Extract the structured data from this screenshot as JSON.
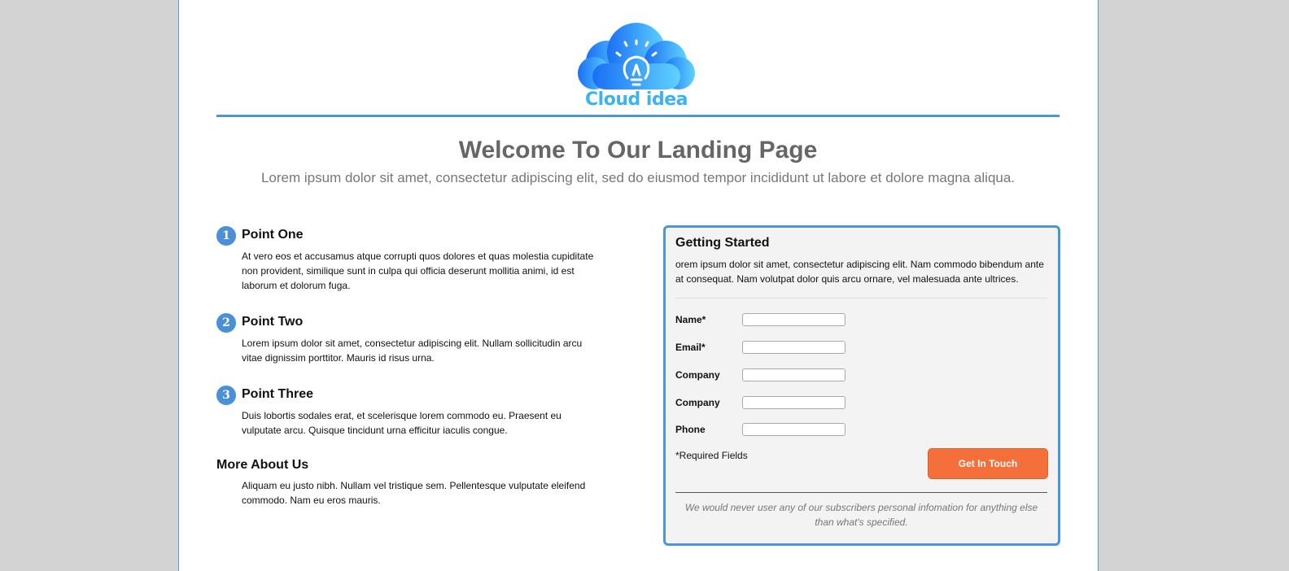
{
  "logo": {
    "text": "Cloud idea"
  },
  "hero": {
    "title": "Welcome To Our Landing Page",
    "subtitle": "Lorem ipsum dolor sit amet, consectetur adipiscing elit, sed do eiusmod tempor incididunt ut labore et dolore magna aliqua."
  },
  "points": [
    {
      "number": "1",
      "title": "Point One",
      "text": "At vero eos et accusamus atque corrupti quos dolores et quas molestia cupiditate non provident, similique sunt in culpa qui officia deserunt mollitia animi, id est laborum et dolorum fuga."
    },
    {
      "number": "2",
      "title": "Point Two",
      "text": "Lorem ipsum dolor sit amet, consectetur adipiscing elit. Nullam sollicitudin arcu vitae dignissim porttitor. Mauris id risus urna."
    },
    {
      "number": "3",
      "title": "Point Three",
      "text": "Duis lobortis sodales erat, et scelerisque lorem commodo eu. Praesent eu vulputate arcu. Quisque tincidunt urna efficitur iaculis congue."
    }
  ],
  "more": {
    "title": "More About Us",
    "text": "Aliquam eu justo nibh. Nullam vel tristique sem. Pellentesque vulputate eleifend commodo. Nam eu eros mauris."
  },
  "form": {
    "title": "Getting Started",
    "intro": "orem ipsum dolor sit amet, consectetur adipiscing elit. Nam commodo bibendum ante at consequat. Nam volutpat dolor quis arcu ornare, vel malesuada ante ultrices.",
    "fields": [
      {
        "label": "Name*",
        "value": ""
      },
      {
        "label": "Email*",
        "value": ""
      },
      {
        "label": "Company",
        "value": ""
      },
      {
        "label": "Company",
        "value": ""
      },
      {
        "label": "Phone",
        "value": ""
      }
    ],
    "required_note": "*Required Fields",
    "submit_label": "Get In Touch",
    "disclaimer": "We would never user any of our subscribers personal infomation for anything else than what's specified."
  },
  "colors": {
    "accent": "#4a96d6",
    "button": "#f56f3b",
    "background": "#d3d3d3"
  }
}
